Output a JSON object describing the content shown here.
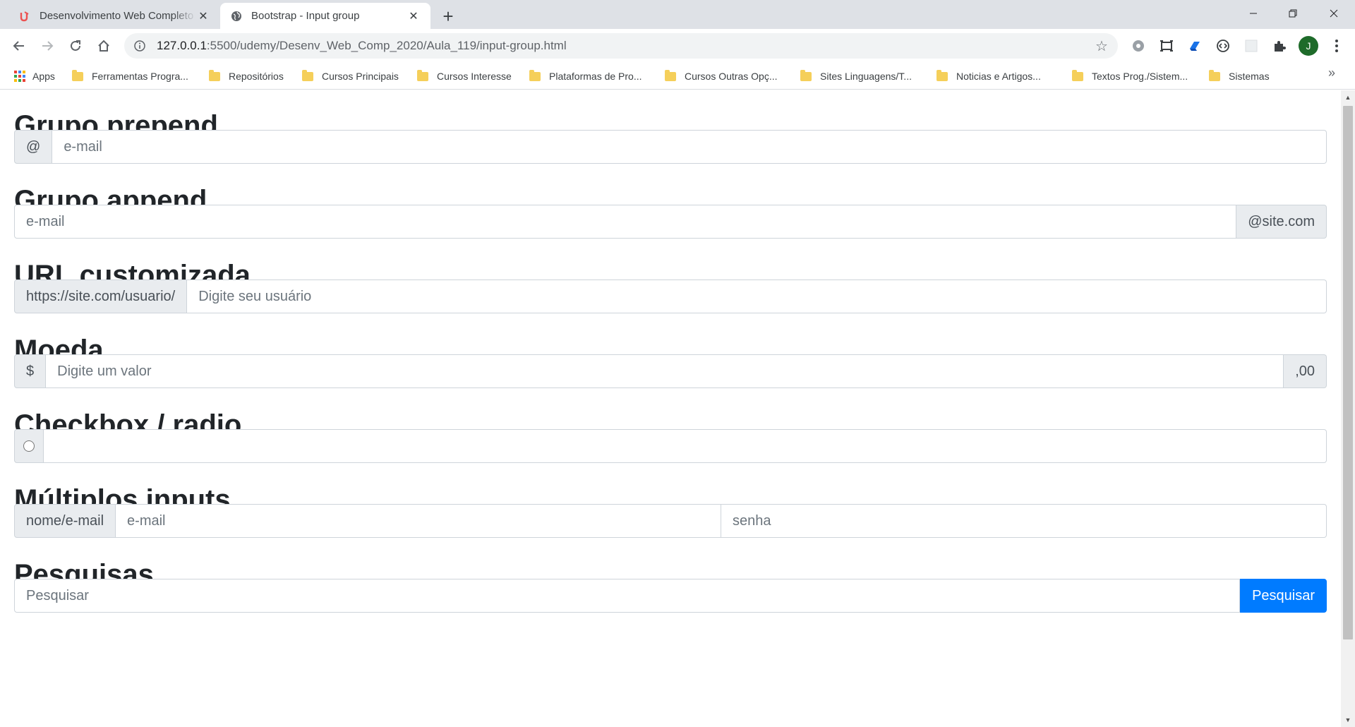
{
  "browser": {
    "tabs": [
      {
        "title": "Desenvolvimento Web Completo",
        "favicon": "udemy-icon",
        "active": false
      },
      {
        "title": "Bootstrap - Input group",
        "favicon": "globe-icon",
        "active": true
      }
    ],
    "address": {
      "host": "127.0.0.1",
      "path": ":5500/udemy/Desenv_Web_Comp_2020/Aula_119/input-group.html"
    },
    "profile_initial": "J",
    "bookmarks": [
      "Apps",
      "Ferramentas Progra...",
      "Repositórios",
      "Cursos Principais",
      "Cursos Interesse",
      "Plataformas de Pro...",
      "Cursos Outras Opç...",
      "Sites Linguagens/T...",
      "Noticias e Artigos...",
      "Textos Prog./Sistem...",
      "Sistemas"
    ]
  },
  "page": {
    "sections": [
      {
        "title": "Grupo prepend",
        "prepend": "@",
        "placeholder": "e-mail"
      },
      {
        "title": "Grupo append",
        "placeholder": "e-mail",
        "append": "@site.com"
      },
      {
        "title": "URL customizada",
        "prepend": "https://site.com/usuario/",
        "placeholder": "Digite seu usuário"
      },
      {
        "title": "Moeda",
        "prepend": "$",
        "placeholder": "Digite um valor",
        "append": ",00"
      },
      {
        "title": "Checkbox / radio",
        "placeholder": ""
      },
      {
        "title": "Múltiplos inputs",
        "prepend": "nome/e-mail",
        "placeholder_1": "e-mail",
        "placeholder_2": "senha"
      },
      {
        "title": "Pesquisas",
        "placeholder": "Pesquisar",
        "button": "Pesquisar"
      }
    ]
  },
  "colors": {
    "primary": "#007bff",
    "addon_bg": "#e9ecef",
    "border": "#ced4da",
    "heading": "#212529"
  }
}
